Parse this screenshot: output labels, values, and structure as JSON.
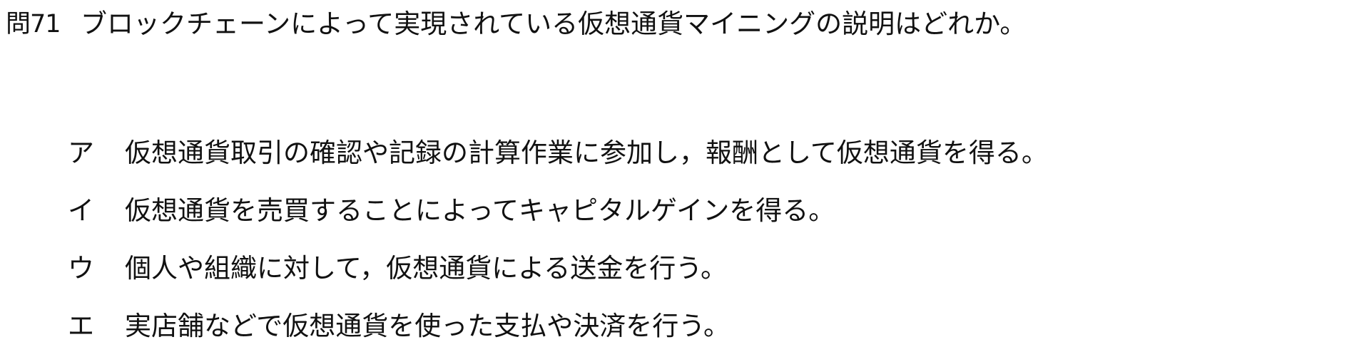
{
  "question": {
    "number": "問71",
    "text": "ブロックチェーンによって実現されている仮想通貨マイニングの説明はどれか。"
  },
  "choices": [
    {
      "label": "ア",
      "text": "仮想通貨取引の確認や記録の計算作業に参加し，報酬として仮想通貨を得る。"
    },
    {
      "label": "イ",
      "text": "仮想通貨を売買することによってキャピタルゲインを得る。"
    },
    {
      "label": "ウ",
      "text": "個人や組織に対して，仮想通貨による送金を行う。"
    },
    {
      "label": "エ",
      "text": "実店舗などで仮想通貨を使った支払や決済を行う。"
    }
  ]
}
